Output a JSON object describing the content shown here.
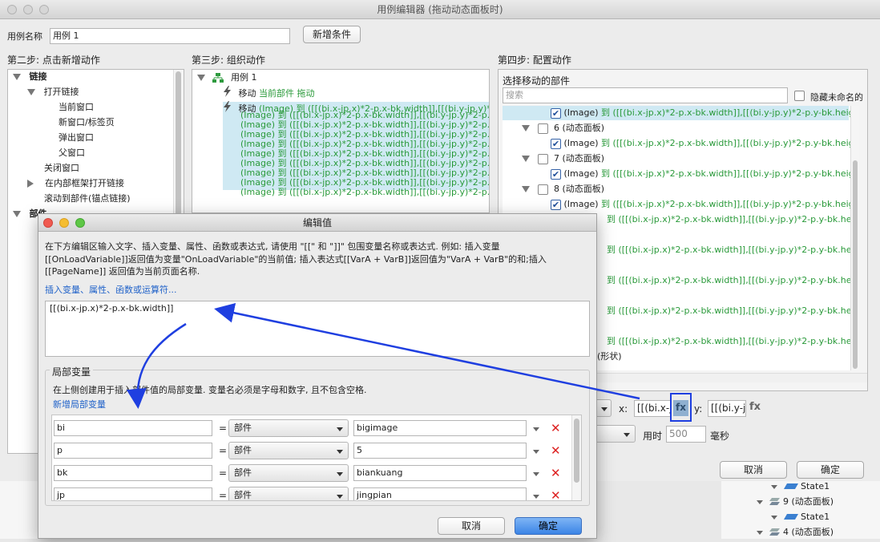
{
  "main_window": {
    "title": "用例编辑器 (拖动动态面板时)",
    "case_name_label": "用例名称",
    "case_name_value": "用例 1",
    "add_condition_button": "新增条件",
    "step2": {
      "title": "第二步: 点击新增动作",
      "tree": [
        {
          "label": "链接",
          "level": 0,
          "expanded": true,
          "bold": true
        },
        {
          "label": "打开链接",
          "level": 1,
          "expanded": true
        },
        {
          "label": "当前窗口",
          "level": 2
        },
        {
          "label": "新窗口/标签页",
          "level": 2
        },
        {
          "label": "弹出窗口",
          "level": 2
        },
        {
          "label": "父窗口",
          "level": 2
        },
        {
          "label": "关闭窗口",
          "level": 1
        },
        {
          "label": "在内部框架打开链接",
          "level": 1,
          "collapsed": true
        },
        {
          "label": "滚动到部件(锚点链接)",
          "level": 1
        },
        {
          "label": "部件",
          "level": 0,
          "expanded": true
        }
      ]
    },
    "step3": {
      "title": "第三步: 组织动作",
      "case_label": "用例 1",
      "action1_prefix": "移动",
      "action1_green": "当前部件 拖动",
      "action2_prefix": "移动",
      "action2_line1": "(Image) 到 ([[(bi.x-jp.x)*2-p.x-bk.width]],[[(bi.y-jp.y)*2",
      "action2_lines": [
        "(Image) 到 ([[(bi.x-jp.x)*2-p.x-bk.width]],[[(bi.y-jp.y)*2-p.y",
        "(Image) 到 ([[(bi.x-jp.x)*2-p.x-bk.width]],[[(bi.y-jp.y)*2-p.y",
        "(Image) 到 ([[(bi.x-jp.x)*2-p.x-bk.width]],[[(bi.y-jp.y)*2-p.y",
        "(Image) 到 ([[(bi.x-jp.x)*2-p.x-bk.width]],[[(bi.y-jp.y)*2-p.y",
        "(Image) 到 ([[(bi.x-jp.x)*2-p.x-bk.width]],[[(bi.y-jp.y)*2-p.y",
        "(Image) 到 ([[(bi.x-jp.x)*2-p.x-bk.width]],[[(bi.y-jp.y)*2-p.y",
        "(Image) 到 ([[(bi.x-jp.x)*2-p.x-bk.width]],[[(bi.y-jp.y)*2-p.y",
        "(Image) 到 ([[(bi.x-jp.x)*2-p.x-bk.width]],[[(bi.y-jp.y)*2-p.y",
        "(Image) 到 ([[(bi.x-jp.x)*2-p.x-bk.width]],[[(bi.y-jp.y)*2-p.y"
      ]
    },
    "step4": {
      "title": "第四步: 配置动作",
      "select_title": "选择移动的部件",
      "search_placeholder": "搜索",
      "hide_unnamed_label": "隐藏未命名的",
      "image_prefix": "(Image)",
      "image_to": "到",
      "image_expr": "([[(bi.x-jp.x)*2-p.x-bk.width]],[[(bi.y-jp.y)*2-p.y-bk.heigh",
      "panel6": "6 (动态面板)",
      "panel7": "7 (动态面板)",
      "panel8": "8 (动态面板)",
      "hidden_row_expr": "到 ([[(bi.x-jp.x)*2-p.x-bk.width]],[[(bi.y-jp.y)*2-p.y-bk.heigh",
      "shape_label": "(形状)",
      "x_label": "x:",
      "x_value": "[[(bi.x-j",
      "fx_label": "fx",
      "y_label": "y:",
      "y_value": "[[(bi.y-j",
      "duration_label": "用时",
      "duration_value": "500",
      "duration_unit": "毫秒",
      "cancel_button": "取消",
      "ok_button": "确定"
    },
    "background_tree": {
      "items": [
        "State1",
        "9 (动态面板)",
        "State1",
        "4 (动态面板)"
      ]
    }
  },
  "dialog": {
    "title": "编辑值",
    "description_line1": "在下方编辑区输入文字、插入变量、属性、函数或表达式, 请使用 \"[[\" 和 \"]]\" 包围变量名称或表达式. 例如: 插入变量",
    "description_line2": "[[OnLoadVariable]]返回值为变量\"OnLoadVariable\"的当前值; 插入表达式[[VarA + VarB]]返回值为\"VarA + VarB\"的和;插入",
    "description_line3": "[[PageName]] 返回值为当前页面名称.",
    "insert_link": "插入变量、属性、函数或运算符...",
    "editor_value": "[[(bi.x-jp.x)*2-p.x-bk.width]]",
    "local_vars_title": "局部变量",
    "local_vars_desc": "在上侧创建用于插入部件值的局部变量. 变量名必须是字母和数字, 且不包含空格.",
    "add_local_var_link": "新增局部变量",
    "variables": [
      {
        "name": "bi",
        "eq": "=",
        "type": "部件",
        "target": "bigimage"
      },
      {
        "name": "p",
        "eq": "=",
        "type": "部件",
        "target": "5"
      },
      {
        "name": "bk",
        "eq": "=",
        "type": "部件",
        "target": "biankuang"
      },
      {
        "name": "jp",
        "eq": "=",
        "type": "部件",
        "target": "jingpian"
      }
    ],
    "cancel_button": "取消",
    "ok_button": "确定"
  },
  "colors": {
    "accent_blue": "#1f3fe0",
    "link_blue": "#2062c9",
    "green_text": "#2a9a3a",
    "selection": "#cfe9f3",
    "delete_red": "#dd2222"
  }
}
